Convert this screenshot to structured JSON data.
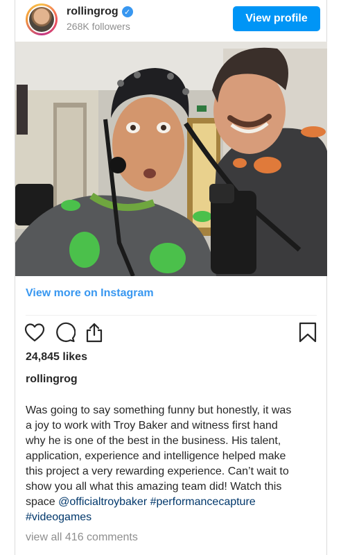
{
  "header": {
    "username": "rollingrog",
    "verified_mark": "✓",
    "followers": "268K followers",
    "view_profile_label": "View profile"
  },
  "media": {
    "description_icon": "photo"
  },
  "view_more_label": "View more on Instagram",
  "actions": {
    "like_icon": "heart-icon",
    "comment_icon": "comment-icon",
    "share_icon": "share-icon",
    "save_icon": "bookmark-icon"
  },
  "likes": "24,845 likes",
  "owner": "rollingrog",
  "caption": {
    "line1": "Was going to say something funny but honestly, it was",
    "line2": "a joy to work with Troy Baker and witness first hand",
    "line3": "why he is one of the best in the business. His talent,",
    "line4": "application, experience and intelligence helped make",
    "line5": "this project a very rewarding experience. Can’t wait to",
    "line6": "show you all what this amazing team did! Watch this",
    "line7_prefix": "space ",
    "mention": "@officialtroybaker",
    "hashtag1": "#performancecapture",
    "hashtag2": "#videogames"
  },
  "comments_link": "view all 416 comments",
  "colors": {
    "accent": "#0095f6",
    "link": "#3897f0",
    "tag": "#00376b",
    "muted": "#8e8e8e"
  }
}
